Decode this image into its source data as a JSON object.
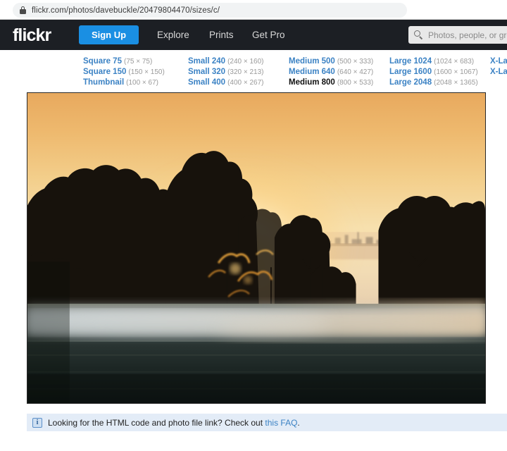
{
  "browser": {
    "url": "flickr.com/photos/davebuckle/20479804470/sizes/c/",
    "lock_icon": "lock-icon"
  },
  "header": {
    "logo": "flickr",
    "signup_label": "Sign Up",
    "nav": [
      {
        "label": "Explore"
      },
      {
        "label": "Prints"
      },
      {
        "label": "Get Pro"
      }
    ],
    "search": {
      "icon": "search-icon",
      "placeholder": "Photos, people, or groups",
      "value": ""
    }
  },
  "sizes": {
    "columns": [
      {
        "rows": [
          {
            "name": "Square 75",
            "dims": "(75 × 75)",
            "active": false
          },
          {
            "name": "Square 150",
            "dims": "(150 × 150)",
            "active": false
          },
          {
            "name": "Thumbnail",
            "dims": "(100 × 67)",
            "active": false
          }
        ]
      },
      {
        "rows": [
          {
            "name": "Small 240",
            "dims": "(240 × 160)",
            "active": false
          },
          {
            "name": "Small 320",
            "dims": "(320 × 213)",
            "active": false
          },
          {
            "name": "Small 400",
            "dims": "(400 × 267)",
            "active": false
          }
        ]
      },
      {
        "rows": [
          {
            "name": "Medium 500",
            "dims": "(500 × 333)",
            "active": false
          },
          {
            "name": "Medium 640",
            "dims": "(640 × 427)",
            "active": false
          },
          {
            "name": "Medium 800",
            "dims": "(800 × 533)",
            "active": true
          }
        ]
      },
      {
        "rows": [
          {
            "name": "Large 1024",
            "dims": "(1024 × 683)",
            "active": false
          },
          {
            "name": "Large 1600",
            "dims": "(1600 × 1067)",
            "active": false
          },
          {
            "name": "Large 2048",
            "dims": "(2048 × 1365)",
            "active": false
          }
        ]
      },
      {
        "rows": [
          {
            "name": "X-Lar",
            "dims": "",
            "active": false
          },
          {
            "name": "X-Lar",
            "dims": "",
            "active": false
          }
        ]
      }
    ]
  },
  "photo": {
    "alt": "Sunset over a misty field with silhouetted trees"
  },
  "faq": {
    "info_icon": "info-icon",
    "text_before": "Looking for the HTML code and photo file link? Check out ",
    "link_label": "this FAQ",
    "text_after": "."
  },
  "colors": {
    "header_bg": "#1c1f24",
    "accent_blue": "#1a8fe3",
    "link_blue": "#3b82c4",
    "faq_bg": "#e3ecf7"
  }
}
